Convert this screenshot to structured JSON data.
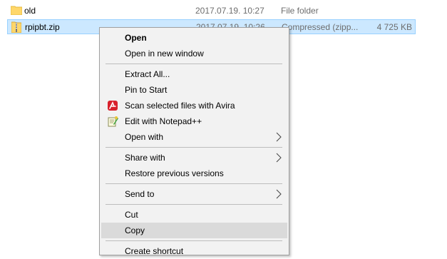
{
  "files": [
    {
      "name": "old",
      "date": "2017.07.19. 10:27",
      "type": "File folder",
      "size": "",
      "icon": "folder-icon"
    },
    {
      "name": "rpipbt.zip",
      "date": "2017.07.19. 10:26",
      "type": "Compressed (zipp...",
      "size": "4 725 KB",
      "icon": "zip-folder-icon"
    }
  ],
  "context_menu": {
    "open": "Open",
    "open_new_window": "Open in new window",
    "extract_all": "Extract All...",
    "pin_to_start": "Pin to Start",
    "scan_avira": "Scan selected files with Avira",
    "edit_notepad": "Edit with Notepad++",
    "open_with": "Open with",
    "share_with": "Share with",
    "restore_versions": "Restore previous versions",
    "send_to": "Send to",
    "cut": "Cut",
    "copy": "Copy",
    "partial_next": "Create shortcut"
  },
  "colors": {
    "selection_bg": "#cce8ff",
    "menu_bg": "#f2f2f2",
    "hover_bg": "#dadada",
    "avira_red": "#d8212c"
  }
}
